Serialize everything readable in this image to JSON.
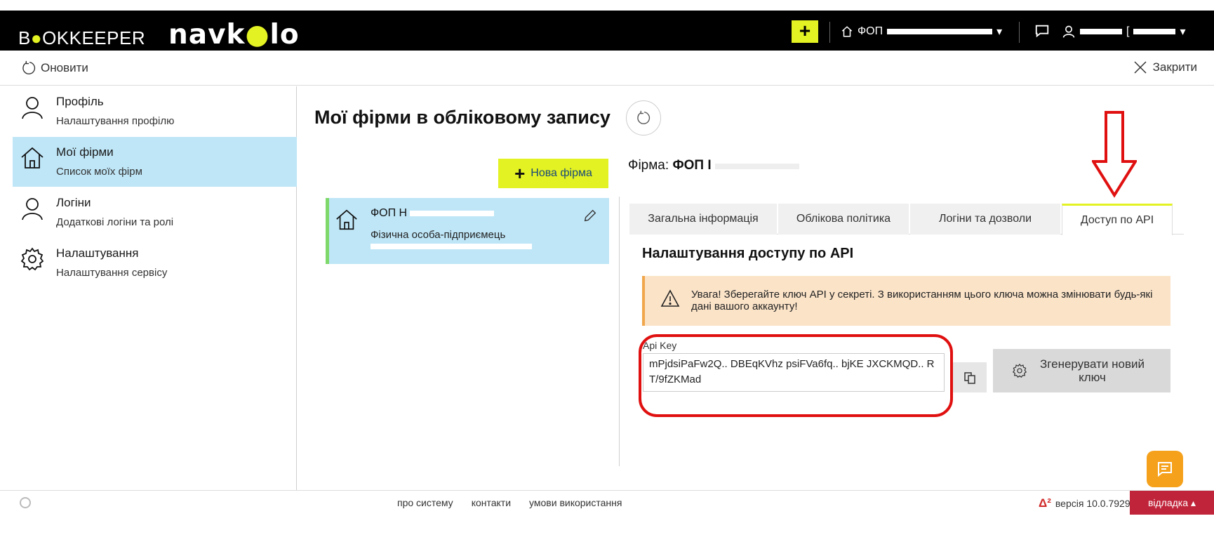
{
  "header": {
    "logo_primary_prefix": "B",
    "logo_primary_accent": "●",
    "logo_primary_suffix": "OKKEEPER",
    "logo_secondary_prefix": "navk",
    "logo_secondary_accent": "●",
    "logo_secondary_suffix": "lo",
    "add_label": "+",
    "firm_selector": "ФОП",
    "user_selector": "["
  },
  "toolbar": {
    "refresh_label": "Оновити",
    "close_label": "Закрити"
  },
  "sidebar": {
    "items": [
      {
        "title": "Профіль",
        "subtitle": "Налаштування профілю"
      },
      {
        "title": "Мої фірми",
        "subtitle": "Список моїх фірм"
      },
      {
        "title": "Логіни",
        "subtitle": "Додаткові логіни та ролі"
      },
      {
        "title": "Налаштування",
        "subtitle": "Налаштування сервісу"
      }
    ]
  },
  "main": {
    "title": "Мої фірми в обліковому запису",
    "new_firm_label": "Нова фірма",
    "firm_card": {
      "name": "ФОП Н",
      "type": "Фізична особа-підприємець"
    },
    "firm_label_prefix": "Фірма:",
    "firm_label_value": "ФОП І",
    "tabs": [
      {
        "label": "Загальна інформація"
      },
      {
        "label": "Облікова політика"
      },
      {
        "label": "Логіни та дозволи"
      },
      {
        "label": "Доступ по API"
      }
    ],
    "section_title": "Налаштування доступу по API",
    "warning_text": "Увага! Зберегайте ключ API у секреті. З використанням цього ключа можна змінювати будь-які дані вашого аккаунту!",
    "api_key_label": "Api Key",
    "api_key_value": "mPjdsiPaFw2Q.. DBEqKVhz psiFVa6fq.. bjKE JXCKMQD.. RT/9fZKMad",
    "generate_label": "Згенерувати новий ключ"
  },
  "footer": {
    "links": [
      "про систему",
      "контакти",
      "умови використання"
    ],
    "version_badge": "Δ²",
    "version_text": "версія 10.0.7929",
    "debug_label": "відладка"
  },
  "colors": {
    "accent": "#e3f222",
    "active_bg": "#bfe6f7",
    "warning_bg": "#fbe3c8",
    "annotation_red": "#e01010",
    "debug_red": "#c0243a",
    "chat_orange": "#f5a11c"
  }
}
